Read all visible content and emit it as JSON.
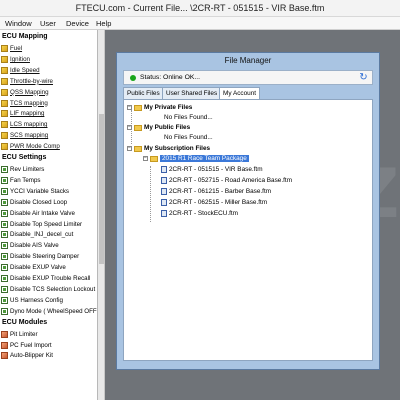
{
  "window": {
    "title": "FTECU.com - Current File... \\2CR-RT - 051515 - VIR Base.ftm"
  },
  "menu": [
    "Window",
    "User",
    "Device",
    "Help"
  ],
  "sidebar": {
    "sections": [
      {
        "title": "ECU Mapping",
        "kind": "map",
        "items": [
          "Fuel",
          "Ignition",
          "Idle Speed",
          "Throttle-by-wire",
          "QSS Mapping",
          "TCS mapping",
          "LIF mapping",
          "LCS mapping",
          "SCS mapping",
          "PWR Mode Comp"
        ]
      },
      {
        "title": "ECU Settings",
        "kind": "set",
        "items": [
          "Rev Limiters",
          "Fan Temps",
          "YCCI Variable Stacks",
          "Disable Closed Loop",
          "Disable Air Intake Valve",
          "Disable Top Speed Limiter",
          "Disable_INJ_decel_cut",
          "Disable AIS Valve",
          "Disable Steering Damper",
          "Disable EXUP Valve",
          "Disable EXUP Trouble Recall",
          "Disable TCS Selection Lockout",
          "US Harness Config",
          "Dyno Mode ( WheelSpeed OFF"
        ]
      },
      {
        "title": "ECU Modules",
        "kind": "mod",
        "items": [
          "Pit Limiter",
          "PC Fuel Import",
          "Auto-Blipper Kit"
        ]
      }
    ]
  },
  "file_manager": {
    "title": "File Manager",
    "status_text": "Status: Online OK...",
    "tabs": [
      "Public Files",
      "User Shared Files",
      "My Account"
    ],
    "active_tab": "My Account",
    "tree": {
      "private": {
        "label": "My Private Files",
        "empty": "No Files Found..."
      },
      "public": {
        "label": "My Public Files",
        "empty": "No Files Found..."
      },
      "subscription": {
        "label": "My Subscription Files",
        "package": "2015 R1 Race Team Package",
        "files": [
          "2CR-RT - 051515 - VIR Base.ftm",
          "2CR-RT - 052715 - Road America Base.ftm",
          "2CR-RT - 061215 - Barber Base.ftm",
          "2CR-RT - 062515 - Miller Base.ftm",
          "2CR-RT - StockECU.ftm"
        ]
      }
    }
  },
  "watermark": "Z"
}
